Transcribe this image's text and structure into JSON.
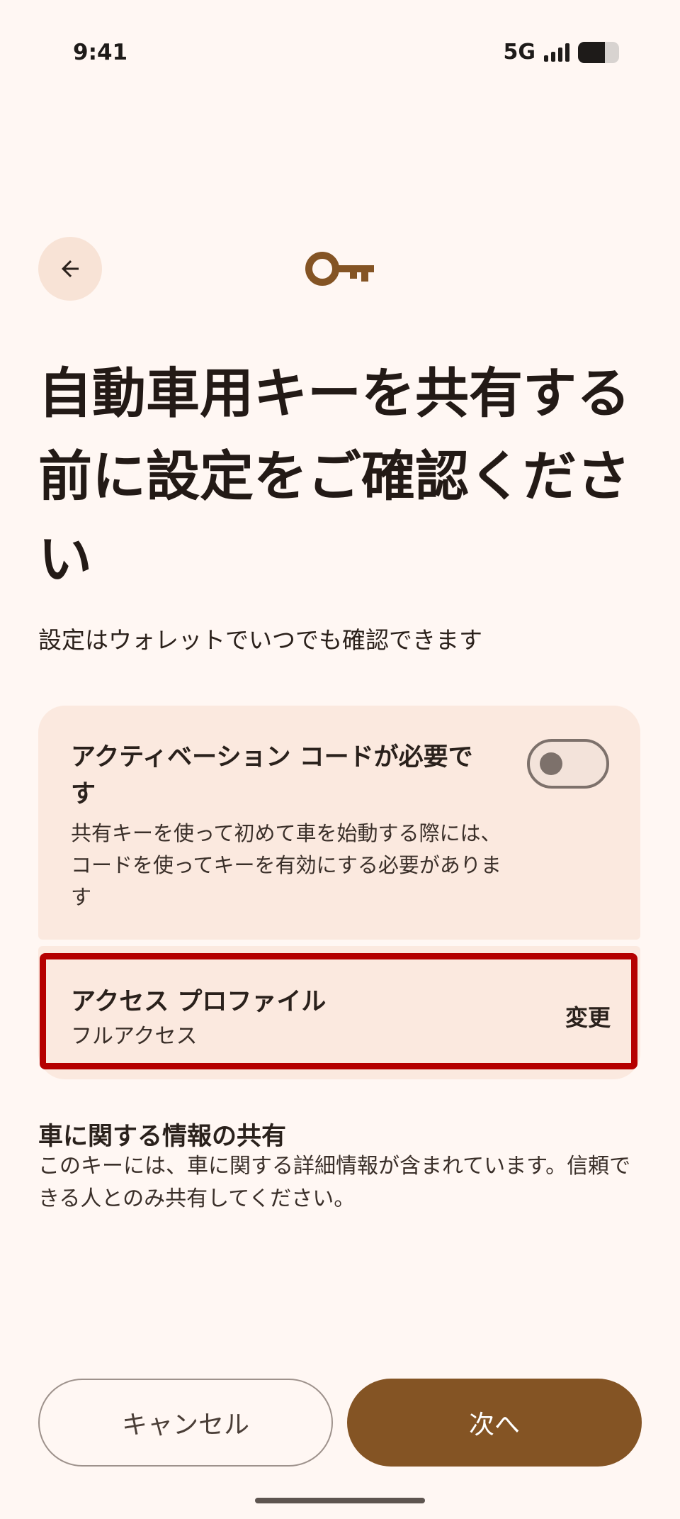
{
  "status_bar": {
    "time": "9:41",
    "network": "5G",
    "signal_icon": "signal-bars-icon",
    "battery_icon": "battery-icon",
    "battery_level": 0.65
  },
  "header": {
    "back_icon": "arrow-back-icon",
    "key_icon": "key-icon"
  },
  "title": "自動車用キーを共有する前に設定をご確認ください",
  "subtitle": "設定はウォレットでいつでも確認できます",
  "activation_setting": {
    "title": "アクティベーション コードが必要です",
    "description": "共有キーを使って初めて車を始動する際には、コードを使ってキーを有効にする必要があります",
    "enabled": false
  },
  "access_profile": {
    "title": "アクセス プロファイル",
    "value": "フルアクセス",
    "change_label": "変更"
  },
  "info_section": {
    "title": "車に関する情報の共有",
    "description": "このキーには、車に関する詳細情報が含まれています。信頼できる人とのみ共有してください。"
  },
  "footer": {
    "cancel_label": "キャンセル",
    "next_label": "次へ"
  },
  "colors": {
    "background": "#FFF7F3",
    "card": "#FBE9DF",
    "accent": "#845424",
    "highlight": "#B50000"
  }
}
